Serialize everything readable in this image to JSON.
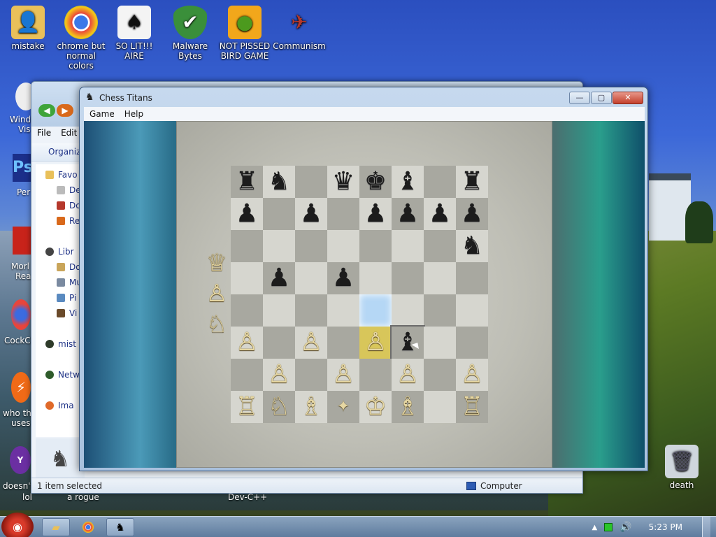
{
  "desktop": {
    "icons": [
      {
        "label": "mistake",
        "icon": "folder-user-icon",
        "color": "#e9c05a"
      },
      {
        "label": "chrome but normal colors",
        "icon": "chrome-icon",
        "color": "#e8e8e8"
      },
      {
        "label": "SO LIT!!! AIRE",
        "icon": "spades-card-icon",
        "color": "#f2f2f2"
      },
      {
        "label": "Malware Bytes",
        "icon": "shield-check-icon",
        "color": "#3a8f3a"
      },
      {
        "label": "NOT PISSED BIRD GAME",
        "icon": "green-pig-icon",
        "color": "#f2a71b"
      },
      {
        "label": "Communism",
        "icon": "emblem-icon",
        "color": "#b5382c"
      },
      {
        "label": "death",
        "icon": "recycle-bin-icon",
        "color": "#cfd6dd"
      }
    ],
    "left_partial_labels": [
      "Windo",
      "Vis",
      "Per",
      "Morl",
      "Read",
      "CockCl",
      "who th",
      "uses",
      "doesn't",
      "lol",
      "a rogue",
      "Dev-C++"
    ]
  },
  "explorer": {
    "menu": [
      "File",
      "Edit"
    ],
    "toolbar_organize": "Organize",
    "sidebar": [
      "Favo",
      "De",
      "Do",
      "Re",
      "Libr",
      "Do",
      "Mu",
      "Pi",
      "Vi",
      "mist",
      "Netw",
      "Ima"
    ],
    "status_left": "1 item selected",
    "status_right": "Computer"
  },
  "chess": {
    "title": "Chess Titans",
    "menu": [
      "Game",
      "Help"
    ],
    "window_buttons": {
      "minimize": "—",
      "maximize": "▢",
      "close": "✕"
    },
    "board": [
      [
        "br",
        "bn",
        "",
        "",
        "bq",
        "bk",
        "bb",
        "",
        "br"
      ],
      [
        "bp",
        "",
        "bp",
        "",
        "bp",
        "bp",
        "bp",
        "bp"
      ],
      [
        "",
        "",
        "",
        "",
        "",
        "",
        "",
        "bn"
      ],
      [
        "",
        "bp",
        "",
        "bp",
        "",
        "",
        "",
        ""
      ],
      [
        "",
        "",
        "",
        "",
        "",
        "",
        "",
        ""
      ],
      [
        "wp",
        "",
        "wp",
        "",
        "wp",
        "bb",
        "",
        ""
      ],
      [
        "",
        "wp",
        "",
        "wp",
        "",
        "wp",
        "",
        "wp"
      ],
      [
        "wr",
        "wn",
        "wb",
        "",
        "wk",
        "wb",
        "",
        "wr"
      ]
    ],
    "captured": [
      "wq",
      "wp",
      "wn"
    ]
  },
  "taskbar": {
    "clock": "5:23 PM"
  }
}
